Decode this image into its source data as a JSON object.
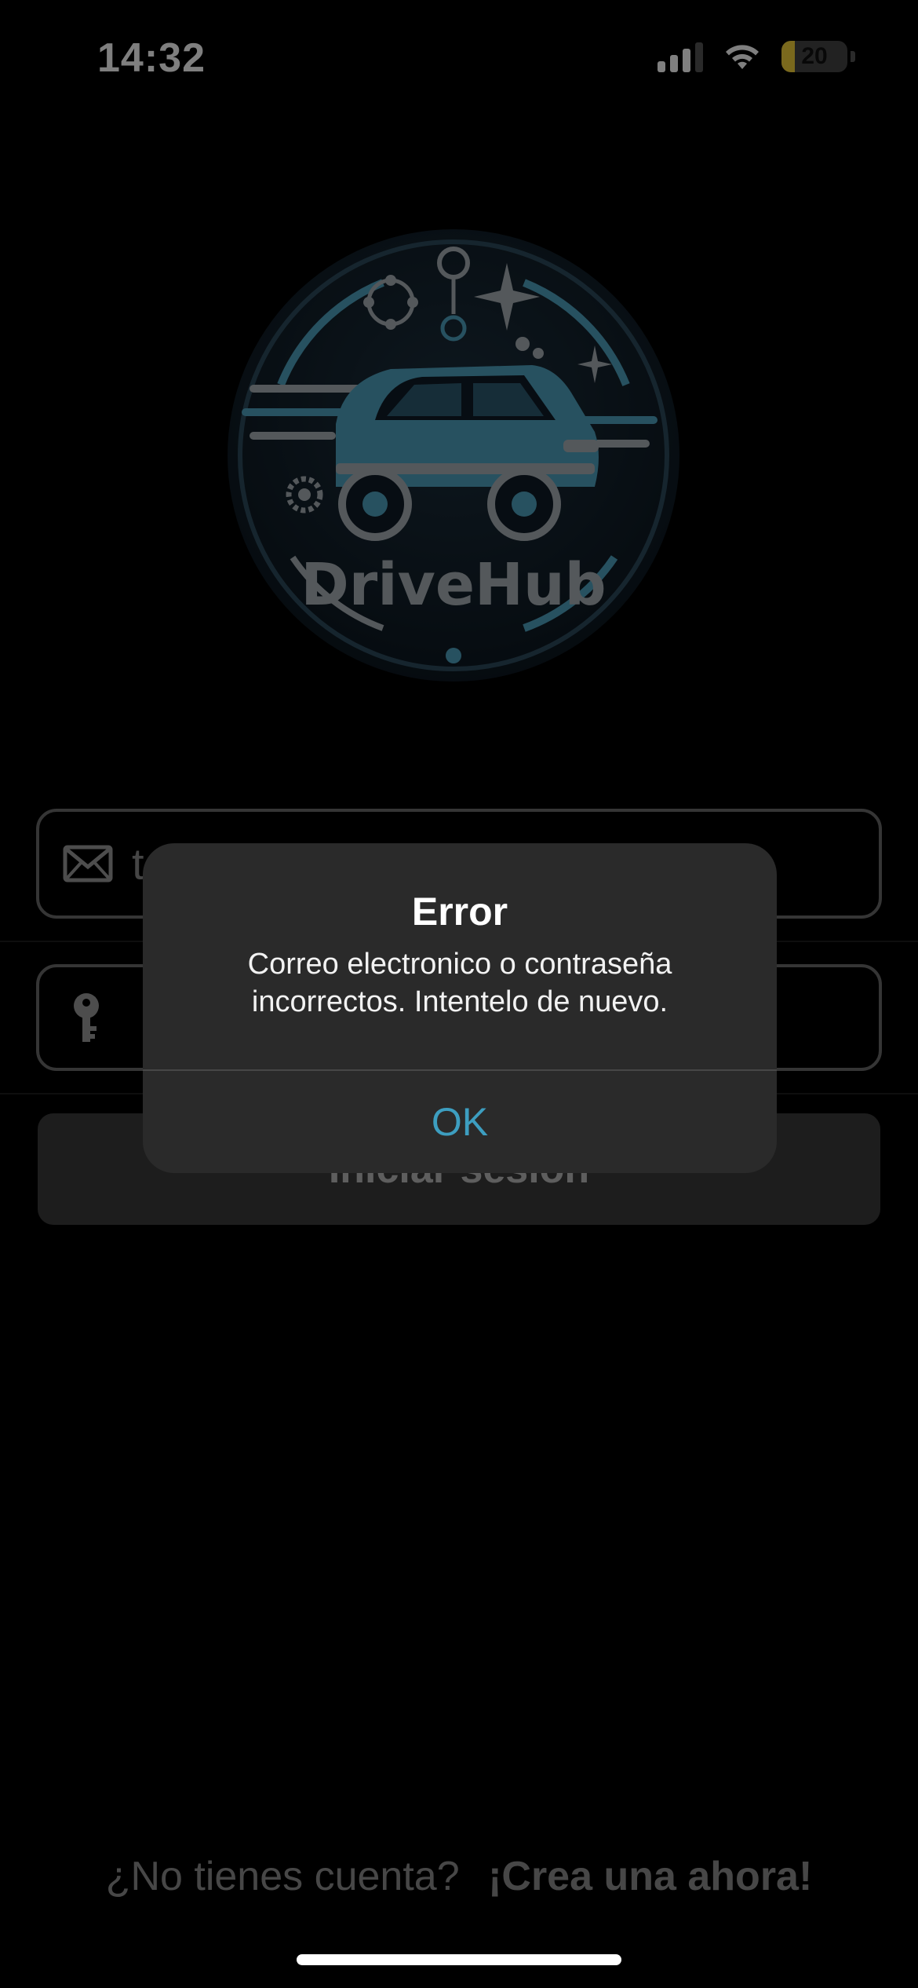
{
  "status_bar": {
    "time": "14:32",
    "battery_level": "20",
    "battery_fraction": 0.2
  },
  "logo": {
    "text": "DriveHub",
    "colors": {
      "primary": "#4fa3c0",
      "dark": "#0e1b27",
      "metal": "#a9b0b6"
    }
  },
  "login": {
    "email_value": "t",
    "submit_label": "Iniciar sesión"
  },
  "signup": {
    "question": "¿No tienes cuenta?",
    "link_label": "¡Crea una ahora!"
  },
  "alert": {
    "title": "Error",
    "message": "Correo electronico o contraseña incorrectos. Intentelo de nuevo.",
    "ok_label": "OK"
  },
  "colors": {
    "background": "#000000",
    "accent": "#3d9ec0",
    "field_border": "#6a6a6a",
    "alert_bg": "#2a2a2a"
  }
}
